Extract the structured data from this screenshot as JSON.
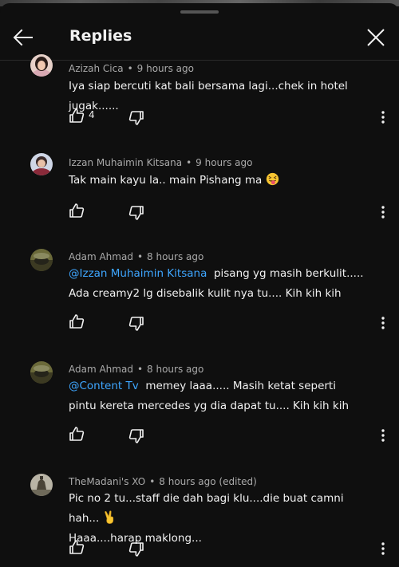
{
  "header": {
    "title": "Replies"
  },
  "comments": [
    {
      "author": "Azizah Cica",
      "time": "9 hours ago",
      "text": "Iya siap bercuti kat bali bersama lagi...chek in hotel jugak......",
      "likes": "4"
    },
    {
      "author": "Izzan Muhaimin Kitsana",
      "time": "9 hours ago",
      "text": "Tak main kayu la.. main Pishang ma",
      "emoji": "squinting-face-with-tongue"
    },
    {
      "author": "Adam Ahmad",
      "time": "8 hours ago",
      "mention": "@Izzan Muhaimin Kitsana",
      "text": "pisang yg masih berkulit..... Ada creamy2 lg disebalik kulit nya tu.... Kih kih kih"
    },
    {
      "author": "Adam Ahmad",
      "time": "8 hours ago",
      "mention": "@Content Tv",
      "text": "memey laaa..... Masih ketat seperti pintu kereta mercedes yg dia dapat tu.... Kih kih kih"
    },
    {
      "author": "TheMadani's XO",
      "time": "8 hours ago (edited)",
      "text": "Pic no 2 tu...staff die dah bagi klu....die buat camni hah...",
      "text2": "Haaa....harap maklong...",
      "emoji": "victory-hand"
    }
  ],
  "colors": {
    "background": "#0f0f0f",
    "text": "#f1f1f1",
    "secondary_text": "#aaaaaa",
    "mention": "#3ea6ff"
  }
}
